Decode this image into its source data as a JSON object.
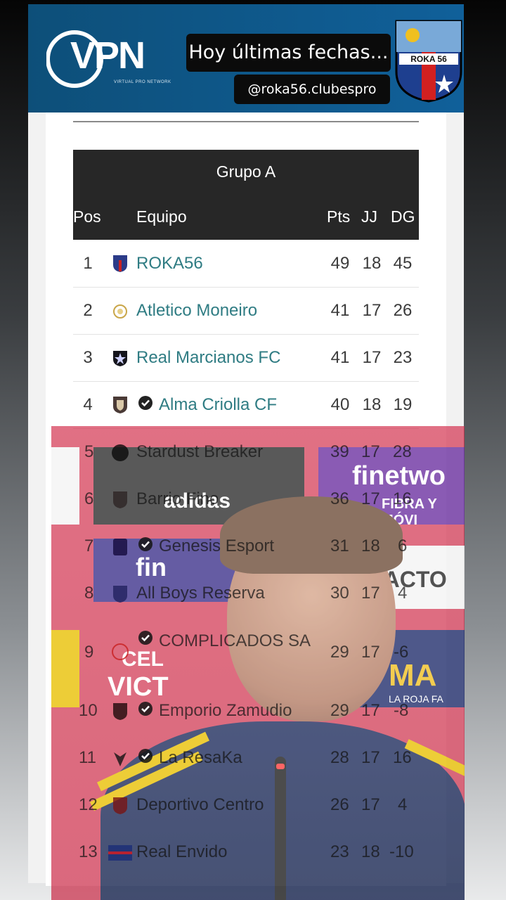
{
  "header": {
    "logo_text": "VPN",
    "logo_sub": "VIRTUAL PRO NETWORK",
    "caption_main": "Hoy últimas fechas...",
    "caption_handle": "@roka56.clubespro",
    "badge_text": "ROKA 56"
  },
  "table": {
    "group_title": "Grupo A",
    "columns": {
      "pos": "Pos",
      "team": "Equipo",
      "pts": "Pts",
      "jj": "JJ",
      "dg": "DG"
    },
    "rows": [
      {
        "pos": "1",
        "team": "ROKA56",
        "pts": "49",
        "jj": "18",
        "dg": "45",
        "verified": false
      },
      {
        "pos": "2",
        "team": "Atletico Moneiro",
        "pts": "41",
        "jj": "17",
        "dg": "26",
        "verified": false
      },
      {
        "pos": "3",
        "team": "Real Marcianos FC",
        "pts": "41",
        "jj": "17",
        "dg": "23",
        "verified": false
      },
      {
        "pos": "4",
        "team": "Alma Criolla CF",
        "pts": "40",
        "jj": "18",
        "dg": "19",
        "verified": true
      },
      {
        "pos": "5",
        "team": "Stardust Breaker",
        "pts": "39",
        "jj": "17",
        "dg": "28",
        "verified": false
      },
      {
        "pos": "6",
        "team": "Barrio Fino",
        "pts": "36",
        "jj": "17",
        "dg": "16",
        "verified": false
      },
      {
        "pos": "7",
        "team": "Genesis Esport",
        "pts": "31",
        "jj": "18",
        "dg": "6",
        "verified": true
      },
      {
        "pos": "8",
        "team": "All Boys Reserva",
        "pts": "30",
        "jj": "17",
        "dg": "4",
        "verified": false
      },
      {
        "pos": "9",
        "team": "COMPLICADOS SA",
        "pts": "29",
        "jj": "17",
        "dg": "-6",
        "verified": true
      },
      {
        "pos": "10",
        "team": "Emporio Zamudio",
        "pts": "29",
        "jj": "17",
        "dg": "-8",
        "verified": true
      },
      {
        "pos": "11",
        "team": "La ResaKa",
        "pts": "28",
        "jj": "17",
        "dg": "16",
        "verified": true
      },
      {
        "pos": "12",
        "team": "Deportivo Centro",
        "pts": "26",
        "jj": "17",
        "dg": "4",
        "verified": false
      },
      {
        "pos": "13",
        "team": "Real Envido",
        "pts": "23",
        "jj": "18",
        "dg": "-10",
        "verified": false
      }
    ]
  },
  "video_background": {
    "sponsor_1": "adidas",
    "sponsor_2": "finetwo",
    "sponsor_2b": "FIBRA Y MÓVI",
    "sponsor_3": "OFACTO",
    "sponsor_4": "MA",
    "sponsor_4b": "LA ROJA FA",
    "wall_text_1": "fin",
    "wall_text_2": "CEL",
    "wall_text_3": "VICT"
  },
  "colors": {
    "header_bg": "#10609a",
    "table_head_bg": "#272727",
    "team_link": "#2f7c83",
    "video_red": "#d22846"
  }
}
